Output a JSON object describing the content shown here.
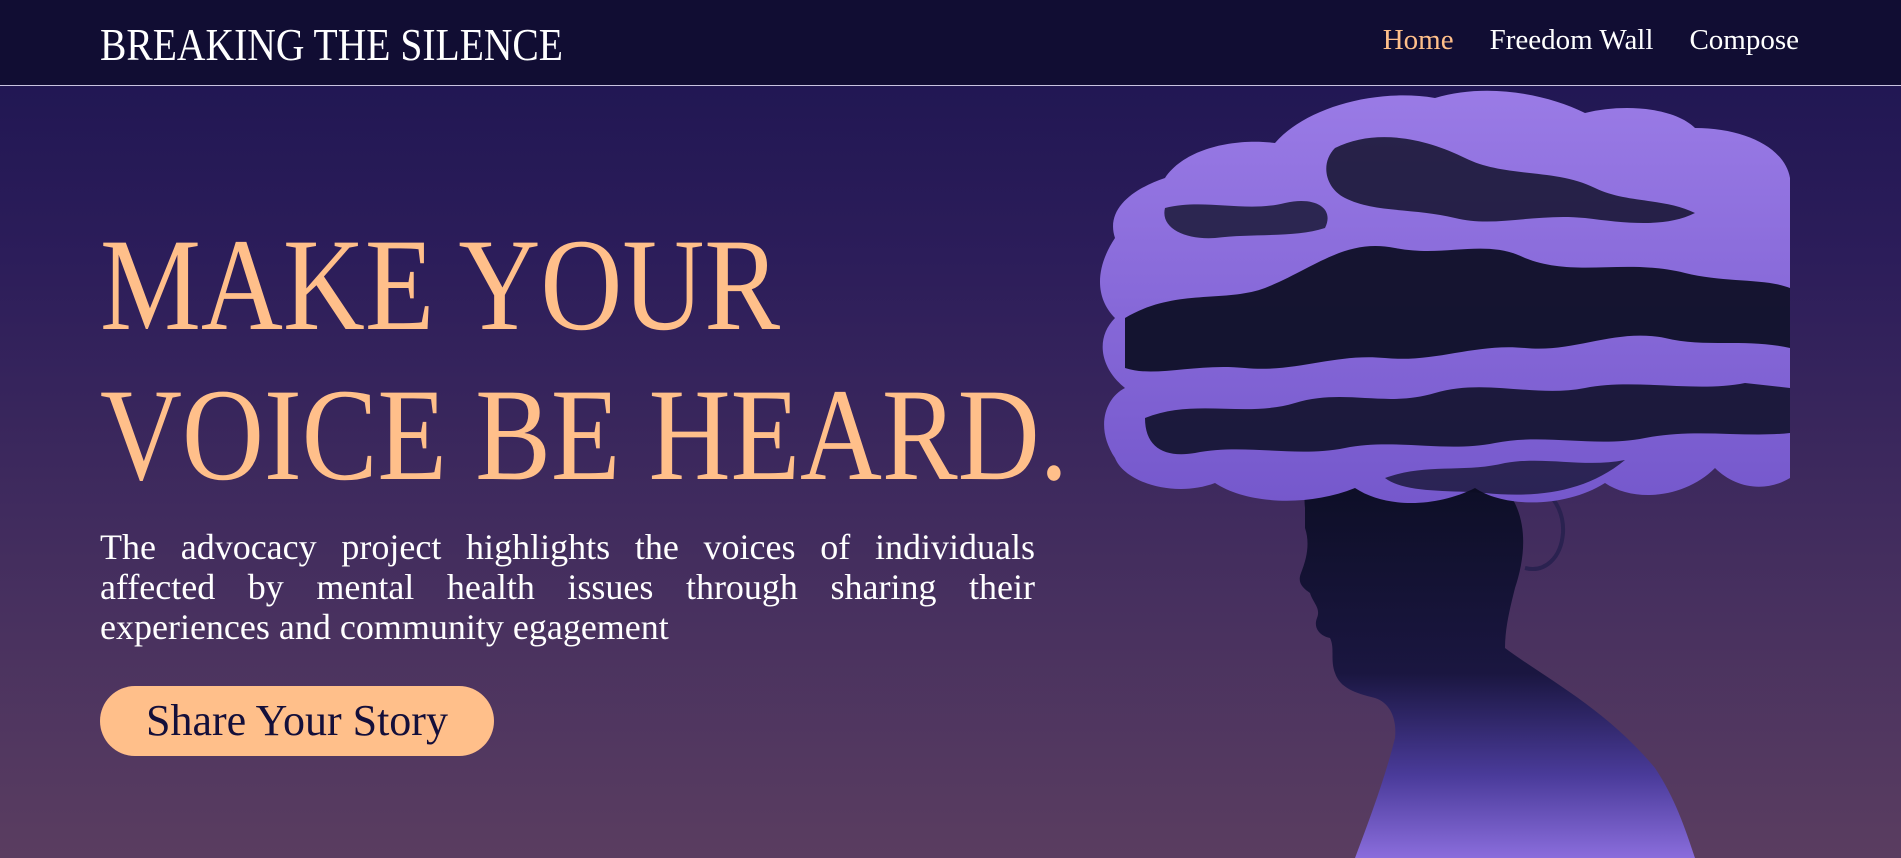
{
  "nav": {
    "brand": "BREAKING THE SILENCE",
    "links": [
      {
        "label": "Home",
        "active": true
      },
      {
        "label": "Freedom Wall",
        "active": false
      },
      {
        "label": "Compose",
        "active": false
      }
    ]
  },
  "hero": {
    "headline_line1": "MAKE YOUR",
    "headline_line2": "VOICE BE HEARD.",
    "description": "The advocacy project highlights the voices of individuals affected by mental health issues through sharing their experiences and community egagement",
    "cta_label": "Share Your Story",
    "illustration": "woman-silhouette-with-cloud-head"
  },
  "colors": {
    "accent": "#ffbf8a",
    "nav_background": "#110d33",
    "text": "#ffffff",
    "illustration_light": "#8a6ddc",
    "illustration_dark": "#0b0d22"
  }
}
